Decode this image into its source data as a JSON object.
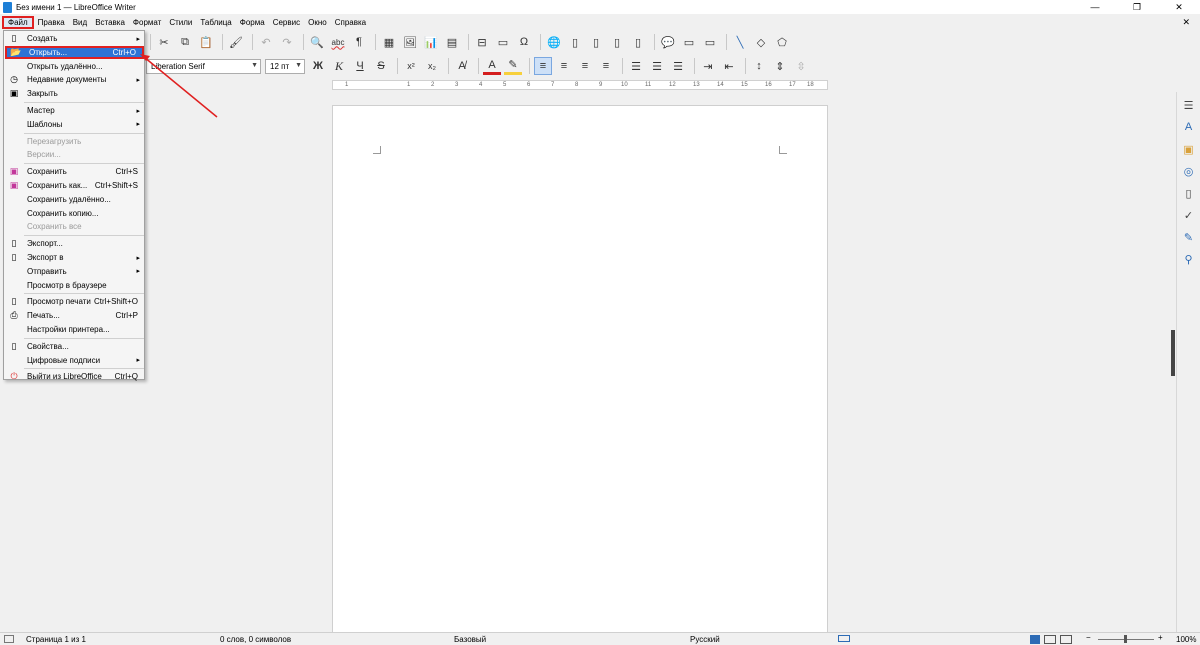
{
  "window": {
    "title": "Без имени 1 — LibreOffice Writer",
    "controls": [
      "—",
      "❐",
      "✕"
    ]
  },
  "menubar": {
    "items": [
      "Файл",
      "Правка",
      "Вид",
      "Вставка",
      "Формат",
      "Стили",
      "Таблица",
      "Форма",
      "Сервис",
      "Окно",
      "Справка"
    ],
    "close_doc": "✕"
  },
  "toolbar": {
    "font_name": "Liberation Serif",
    "font_size": "12 пт",
    "bold": "Ж",
    "italic": "К",
    "underline": "Ч",
    "strike": "S",
    "superscript": "x²",
    "subscript": "x₂",
    "spell": "abc",
    "pilcrow": "¶"
  },
  "ruler": {
    "labels": [
      "1",
      "1",
      "2",
      "3",
      "4",
      "5",
      "6",
      "7",
      "8",
      "9",
      "10",
      "11",
      "12",
      "13",
      "14",
      "15",
      "16",
      "17",
      "18"
    ]
  },
  "file_menu": {
    "items": [
      {
        "label": "Создать",
        "shortcut": "",
        "submenu": true,
        "disabled": false,
        "icon": "new-doc-icon",
        "highlight": false
      },
      {
        "label": "Открыть...",
        "shortcut": "Ctrl+O",
        "submenu": false,
        "disabled": false,
        "icon": "folder-open-icon",
        "highlight": true
      },
      {
        "label": "Открыть удалённо...",
        "shortcut": "",
        "submenu": false,
        "disabled": false,
        "icon": "",
        "highlight": false
      },
      {
        "label": "Недавние документы",
        "shortcut": "",
        "submenu": true,
        "disabled": false,
        "icon": "recent-icon",
        "highlight": false
      },
      {
        "label": "Закрыть",
        "shortcut": "",
        "submenu": false,
        "disabled": false,
        "icon": "close-doc-icon",
        "highlight": false
      },
      {
        "sep": true
      },
      {
        "label": "Мастер",
        "shortcut": "",
        "submenu": true,
        "disabled": false,
        "icon": "",
        "highlight": false
      },
      {
        "label": "Шаблоны",
        "shortcut": "",
        "submenu": true,
        "disabled": false,
        "icon": "",
        "highlight": false
      },
      {
        "sep": true
      },
      {
        "label": "Перезагрузить",
        "shortcut": "",
        "submenu": false,
        "disabled": true,
        "icon": "",
        "highlight": false
      },
      {
        "label": "Версии...",
        "shortcut": "",
        "submenu": false,
        "disabled": true,
        "icon": "",
        "highlight": false
      },
      {
        "sep": true
      },
      {
        "label": "Сохранить",
        "shortcut": "Ctrl+S",
        "submenu": false,
        "disabled": false,
        "icon": "save-icon",
        "highlight": false
      },
      {
        "label": "Сохранить как...",
        "shortcut": "Ctrl+Shift+S",
        "submenu": false,
        "disabled": false,
        "icon": "save-as-icon",
        "highlight": false
      },
      {
        "label": "Сохранить удалённо...",
        "shortcut": "",
        "submenu": false,
        "disabled": false,
        "icon": "",
        "highlight": false
      },
      {
        "label": "Сохранить копию...",
        "shortcut": "",
        "submenu": false,
        "disabled": false,
        "icon": "",
        "highlight": false
      },
      {
        "label": "Сохранить все",
        "shortcut": "",
        "submenu": false,
        "disabled": true,
        "icon": "",
        "highlight": false
      },
      {
        "sep": true
      },
      {
        "label": "Экспорт...",
        "shortcut": "",
        "submenu": false,
        "disabled": false,
        "icon": "export-icon",
        "highlight": false
      },
      {
        "label": "Экспорт в",
        "shortcut": "",
        "submenu": true,
        "disabled": false,
        "icon": "export-to-icon",
        "highlight": false
      },
      {
        "label": "Отправить",
        "shortcut": "",
        "submenu": true,
        "disabled": false,
        "icon": "",
        "highlight": false
      },
      {
        "label": "Просмотр в браузере",
        "shortcut": "",
        "submenu": false,
        "disabled": false,
        "icon": "",
        "highlight": false
      },
      {
        "sep": true
      },
      {
        "label": "Просмотр печати",
        "shortcut": "Ctrl+Shift+O",
        "submenu": false,
        "disabled": false,
        "icon": "print-preview-icon",
        "highlight": false
      },
      {
        "label": "Печать...",
        "shortcut": "Ctrl+P",
        "submenu": false,
        "disabled": false,
        "icon": "printer-icon",
        "highlight": false
      },
      {
        "label": "Настройки принтера...",
        "shortcut": "",
        "submenu": false,
        "disabled": false,
        "icon": "",
        "highlight": false
      },
      {
        "sep": true
      },
      {
        "label": "Свойства...",
        "shortcut": "",
        "submenu": false,
        "disabled": false,
        "icon": "properties-icon",
        "highlight": false
      },
      {
        "label": "Цифровые подписи",
        "shortcut": "",
        "submenu": true,
        "disabled": false,
        "icon": "",
        "highlight": false
      },
      {
        "sep": true
      },
      {
        "label": "Выйти из LibreOffice",
        "shortcut": "Ctrl+Q",
        "submenu": false,
        "disabled": false,
        "icon": "exit-icon",
        "highlight": false
      }
    ]
  },
  "statusbar": {
    "page": "Страница 1 из 1",
    "words": "0 слов, 0 символов",
    "style": "Базовый",
    "language": "Русский",
    "zoom": "100%"
  }
}
